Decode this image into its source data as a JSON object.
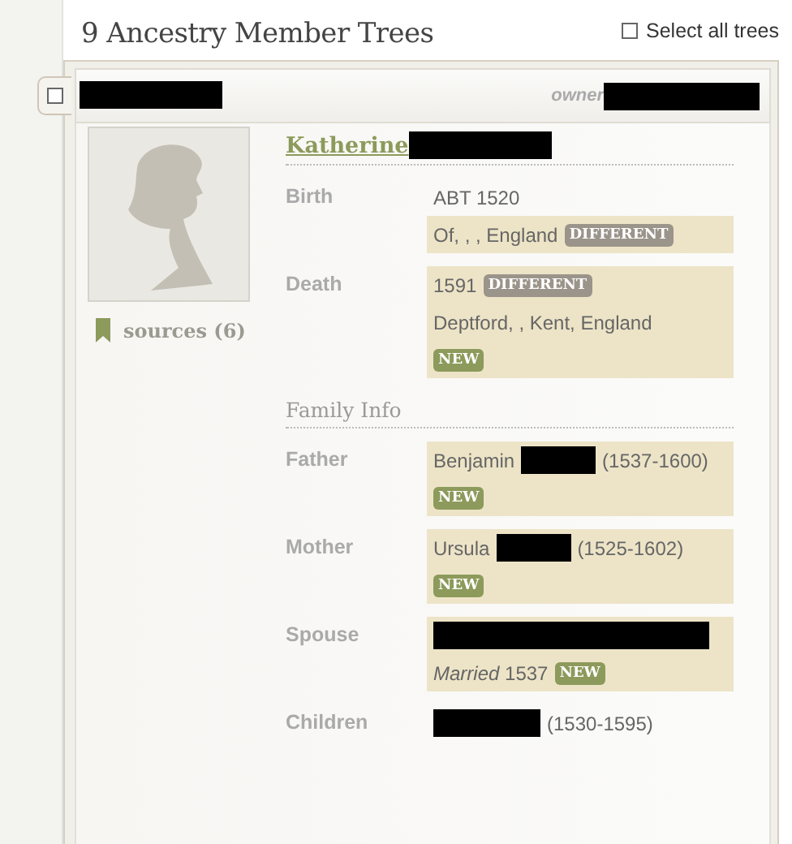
{
  "heading": "9 Ancestry Member Trees",
  "select_all": {
    "label": "Select all trees",
    "checked": false
  },
  "tree": {
    "checked": false,
    "title": [
      {
        "kind": "redacted_m"
      }
    ],
    "owner": [
      {
        "kind": "text",
        "text": "owner"
      },
      {
        "kind": "redacted_l"
      }
    ]
  },
  "person": {
    "name": [
      {
        "kind": "text",
        "text": "Katherine"
      },
      {
        "kind": "redacted_m"
      }
    ],
    "sources": "sources (6)"
  },
  "facts": [
    {
      "label": "Birth",
      "lines": [
        {
          "highlighted": false,
          "parts": [
            {
              "kind": "text",
              "text": "ABT 1520"
            }
          ]
        },
        {
          "highlighted": true,
          "parts": [
            {
              "kind": "text",
              "text": "Of, , , England"
            },
            {
              "kind": "badge",
              "text": "DIFFERENT",
              "color": "#9b948a"
            }
          ]
        }
      ]
    },
    {
      "label": "Death",
      "lines": [
        {
          "highlighted": true,
          "parts": [
            {
              "kind": "text",
              "text": "1591"
            },
            {
              "kind": "badge",
              "text": "DIFFERENT",
              "color": "#9b948a"
            }
          ]
        },
        {
          "highlighted": true,
          "parts": [
            {
              "kind": "text",
              "text": "Deptford, , Kent, England"
            }
          ]
        },
        {
          "highlighted": true,
          "parts": [
            {
              "kind": "badge",
              "text": "NEW",
              "color": "#8c9a5b"
            }
          ]
        }
      ]
    }
  ],
  "family_heading": "Family Info",
  "family": [
    {
      "label": "Father",
      "lines": [
        {
          "highlighted": true,
          "parts": [
            {
              "kind": "text",
              "text": "Benjamin"
            },
            {
              "kind": "redacted_xs"
            },
            {
              "kind": "text",
              "text": "(1537-1600)"
            }
          ]
        },
        {
          "highlighted": true,
          "parts": [
            {
              "kind": "badge",
              "text": "NEW",
              "color": "#8c9a5b"
            }
          ]
        }
      ]
    },
    {
      "label": "Mother",
      "lines": [
        {
          "highlighted": true,
          "parts": [
            {
              "kind": "text",
              "text": "Ursula"
            },
            {
              "kind": "redacted_xs"
            },
            {
              "kind": "text",
              "text": "(1525-1602)"
            }
          ]
        },
        {
          "highlighted": true,
          "parts": [
            {
              "kind": "badge",
              "text": "NEW",
              "color": "#8c9a5b"
            }
          ]
        }
      ]
    },
    {
      "label": "Spouse",
      "lines": [
        {
          "highlighted": true,
          "parts": [
            {
              "kind": "redacted_xl"
            }
          ]
        },
        {
          "highlighted": true,
          "parts": [
            {
              "kind": "text",
              "text": "*Married* 1537"
            },
            {
              "kind": "badge",
              "text": "NEW",
              "color": "#8c9a5b"
            }
          ]
        }
      ]
    },
    {
      "label": "Children",
      "lines": [
        {
          "highlighted": false,
          "parts": [
            {
              "kind": "redacted_s"
            },
            {
              "kind": "text",
              "text": "(1530-1595)"
            }
          ]
        }
      ]
    }
  ]
}
